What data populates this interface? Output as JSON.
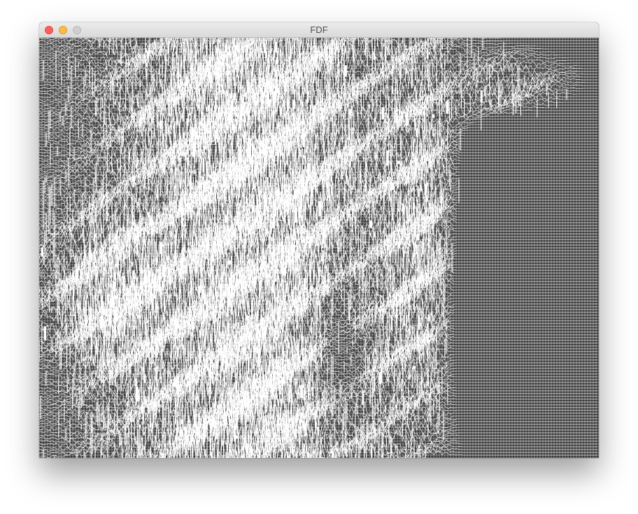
{
  "window": {
    "title": "FDF",
    "controls": {
      "close": "close-button",
      "minimize": "minimize-button",
      "zoom": "zoom-button"
    }
  },
  "canvas": {
    "background_color": "#3a3a3a",
    "line_color": "#ffffff",
    "content": "wireframe-mesh"
  },
  "colors": {
    "close": "#fc605c",
    "minimize": "#fdbc40",
    "zoom_disabled": "#cfcfcf",
    "titlebar": "#e4e4e4"
  }
}
